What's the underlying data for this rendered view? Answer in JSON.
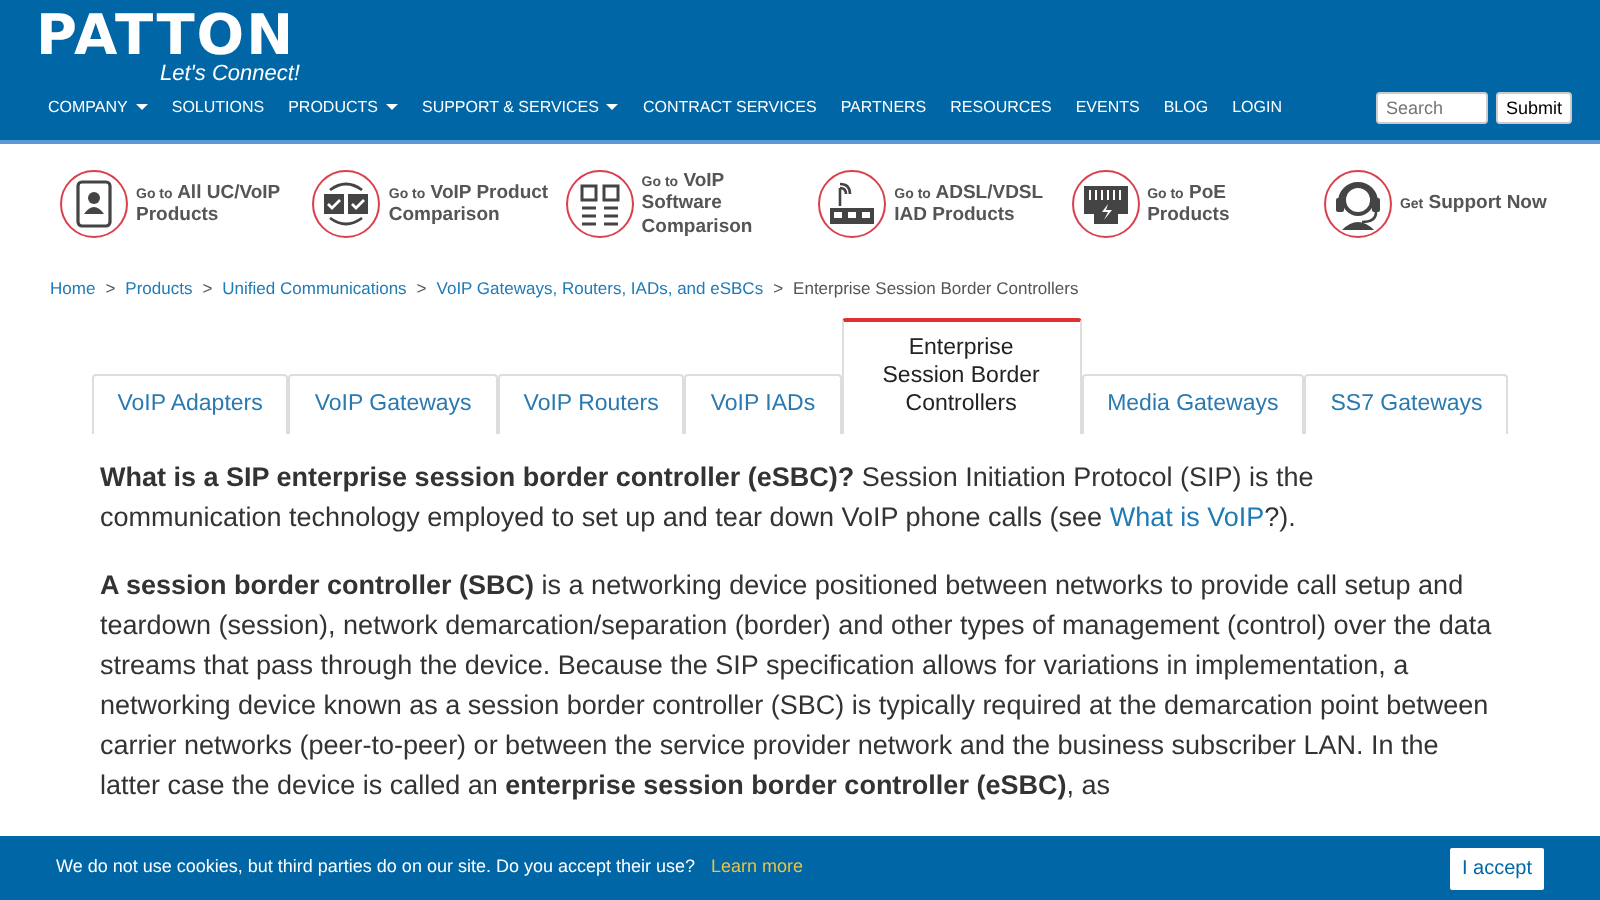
{
  "logo": {
    "name": "PATTON",
    "tagline": "Let's Connect!"
  },
  "nav": [
    {
      "label": "COMPANY",
      "dropdown": true
    },
    {
      "label": "SOLUTIONS",
      "dropdown": false
    },
    {
      "label": "PRODUCTS",
      "dropdown": true
    },
    {
      "label": "SUPPORT & SERVICES",
      "dropdown": true
    },
    {
      "label": "CONTRACT SERVICES",
      "dropdown": false
    },
    {
      "label": "PARTNERS",
      "dropdown": false
    },
    {
      "label": "RESOURCES",
      "dropdown": false
    },
    {
      "label": "EVENTS",
      "dropdown": false
    },
    {
      "label": "BLOG",
      "dropdown": false
    },
    {
      "label": "LOGIN",
      "dropdown": false
    }
  ],
  "search": {
    "placeholder": "Search",
    "button": "Submit"
  },
  "quick_links": [
    {
      "kind": "phone",
      "prefix": "Go to",
      "label": "All UC/VoIP Products"
    },
    {
      "kind": "compare",
      "prefix": "Go to",
      "label": "VoIP Product Comparison"
    },
    {
      "kind": "software",
      "prefix": "Go to",
      "label": "VoIP Software Comparison"
    },
    {
      "kind": "router",
      "prefix": "Go to",
      "label": "ADSL/VDSL IAD Products"
    },
    {
      "kind": "poe",
      "prefix": "Go to",
      "label": "PoE Products"
    },
    {
      "kind": "support",
      "prefix": "Get",
      "label": "Support Now"
    }
  ],
  "breadcrumb": {
    "separator": ">",
    "items": [
      "Home",
      "Products",
      "Unified Communications",
      "VoIP Gateways, Routers, IADs, and eSBCs",
      "Enterprise Session Border Controllers"
    ]
  },
  "tabs": [
    {
      "label": "VoIP Adapters",
      "selected": false
    },
    {
      "label": "VoIP Gateways",
      "selected": false
    },
    {
      "label": "VoIP Routers",
      "selected": false
    },
    {
      "label": "VoIP IADs",
      "selected": false
    },
    {
      "label": "Enterprise Session Border Controllers",
      "selected": true
    },
    {
      "label": "Media Gateways",
      "selected": false
    },
    {
      "label": "SS7 Gateways",
      "selected": false
    }
  ],
  "paragraphs": [
    {
      "text": "**What is a SIP enterprise session border controller (eSBC)?** Session Initiation Protocol (SIP) is the communication technology employed to set up and tear down VoIP phone calls (see ",
      "link": "What is VoIP",
      "after": "?)."
    },
    {
      "text": "**A session border controller (SBC)** is a networking device positioned between networks to provide call setup and teardown (session), network demarcation/separation (border) and other types of management (control) over the data streams that pass through the device. Because the SIP specification allows for variations in implementation, a networking device known as a session border controller (SBC) is typically required at the demarcation point between carrier networks (peer-to-peer) or between the service provider network and the business subscriber LAN. In the latter case the device is called an **enterprise session border controller (eSBC)**, as"
    }
  ],
  "cookie_bar": {
    "text": "We do not use cookies, but third parties do on our site. Do you accept their use?",
    "link": "Learn more",
    "button": "I accept"
  }
}
